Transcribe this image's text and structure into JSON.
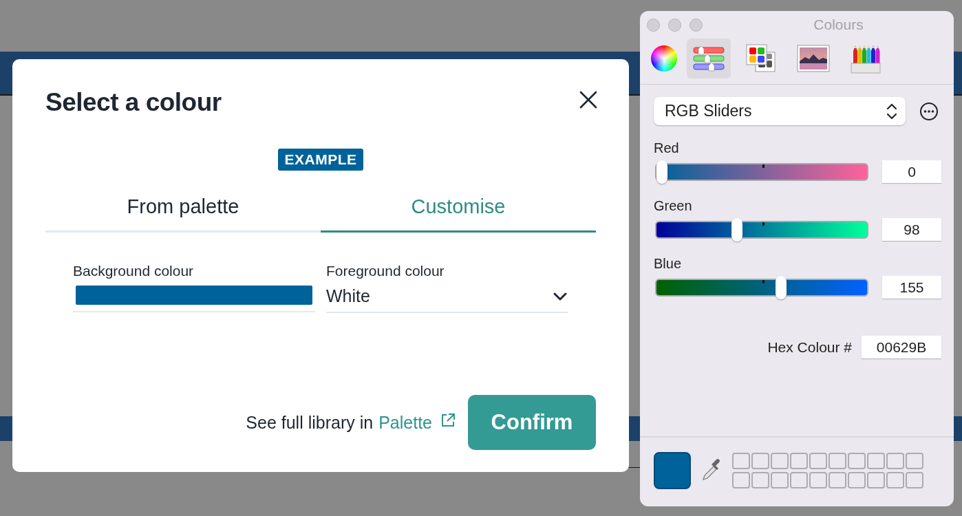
{
  "dialog": {
    "title": "Select a colour",
    "badge": "EXAMPLE",
    "tabs": [
      {
        "label": "From palette",
        "selected": false
      },
      {
        "label": "Customise",
        "selected": true
      }
    ],
    "fields": [
      {
        "kind": "swatch",
        "label": "Background colour",
        "color": "#00629b"
      },
      {
        "kind": "select",
        "label": "Foreground colour",
        "value": "White"
      }
    ],
    "footer": {
      "text": "See full library in",
      "link": "Palette"
    },
    "confirm": "Confirm"
  },
  "colours_panel": {
    "title": "Colours",
    "modes": [
      {
        "kind": "wheel",
        "selected": false
      },
      {
        "kind": "sliders",
        "selected": true
      },
      {
        "kind": "palettes",
        "selected": false
      },
      {
        "kind": "image",
        "selected": false
      },
      {
        "kind": "pencils",
        "selected": false
      }
    ],
    "mode_select": "RGB Sliders",
    "sliders": [
      {
        "label": "Red",
        "level": 0,
        "value": "0"
      },
      {
        "label": "Green",
        "level": 0.384,
        "value": "98"
      },
      {
        "label": "Blue",
        "level": 0.608,
        "value": "155"
      }
    ],
    "hex_label": "Hex Colour #",
    "hex_value": "00629B",
    "colour_well": {
      "color": "#00629b"
    }
  }
}
